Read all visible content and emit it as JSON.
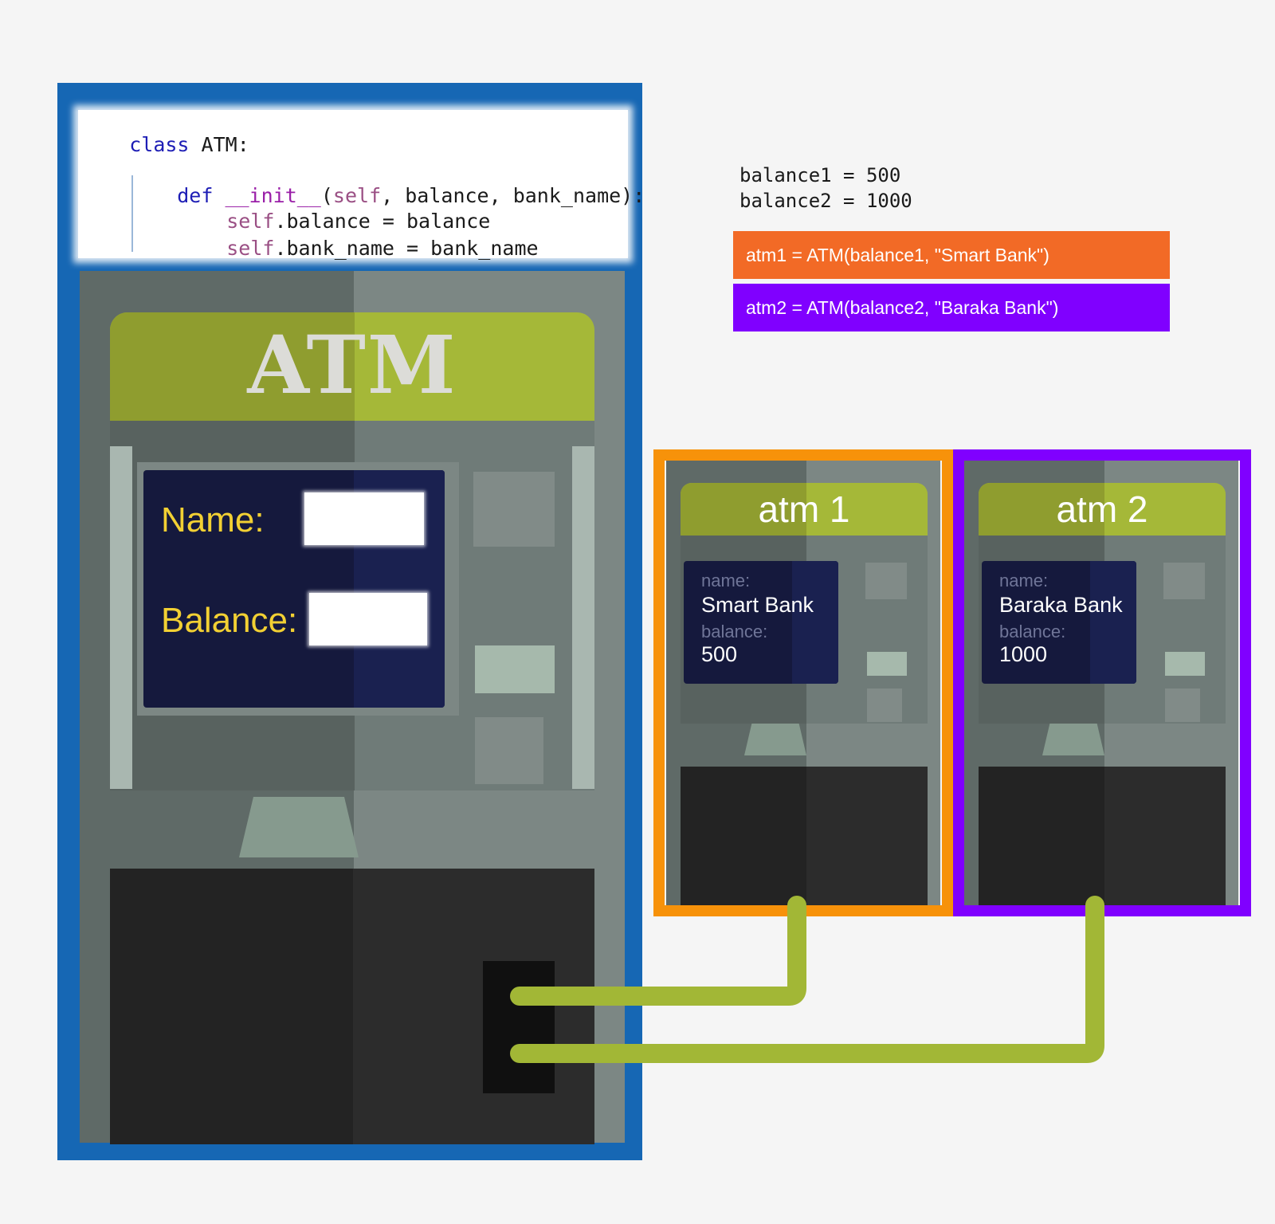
{
  "class_code": {
    "line1_kw": "class",
    "line1_rest": " ATM:",
    "line2_kw": "def",
    "line2_fn": "__init__",
    "line2_paren": "(",
    "line2_self": "self",
    "line2_rest": ", balance, bank_name):",
    "line3_self": "self",
    "line3_rest": ".balance = balance",
    "line4_self": "self",
    "line4_rest": ".bank_name = bank_name"
  },
  "big_atm": {
    "title": "ATM",
    "name_label": "Name:",
    "balance_label": "Balance:"
  },
  "variables": {
    "balance1": "balance1 = 500",
    "balance2": "balance2 = 1000"
  },
  "assignments": {
    "atm1": "atm1 = ATM(balance1, \"Smart Bank\")",
    "atm2": "atm2 = ATM(balance2, \"Baraka Bank\")",
    "atm1_color": "#f26a26",
    "atm2_color": "#8000ff"
  },
  "instances": [
    {
      "title": "atm 1",
      "name_key": "name:",
      "name_value": "Smart Bank",
      "balance_key": "balance:",
      "balance_value": "500",
      "frame_color": "#f7920a"
    },
    {
      "title": "atm 2",
      "name_key": "name:",
      "name_value": "Baraka Bank",
      "balance_key": "balance:",
      "balance_value": "1000",
      "frame_color": "#8000ff"
    }
  ],
  "colors": {
    "class_frame": "#1667b4",
    "connector": "#a2b736",
    "label_yellow": "#f2d033"
  }
}
